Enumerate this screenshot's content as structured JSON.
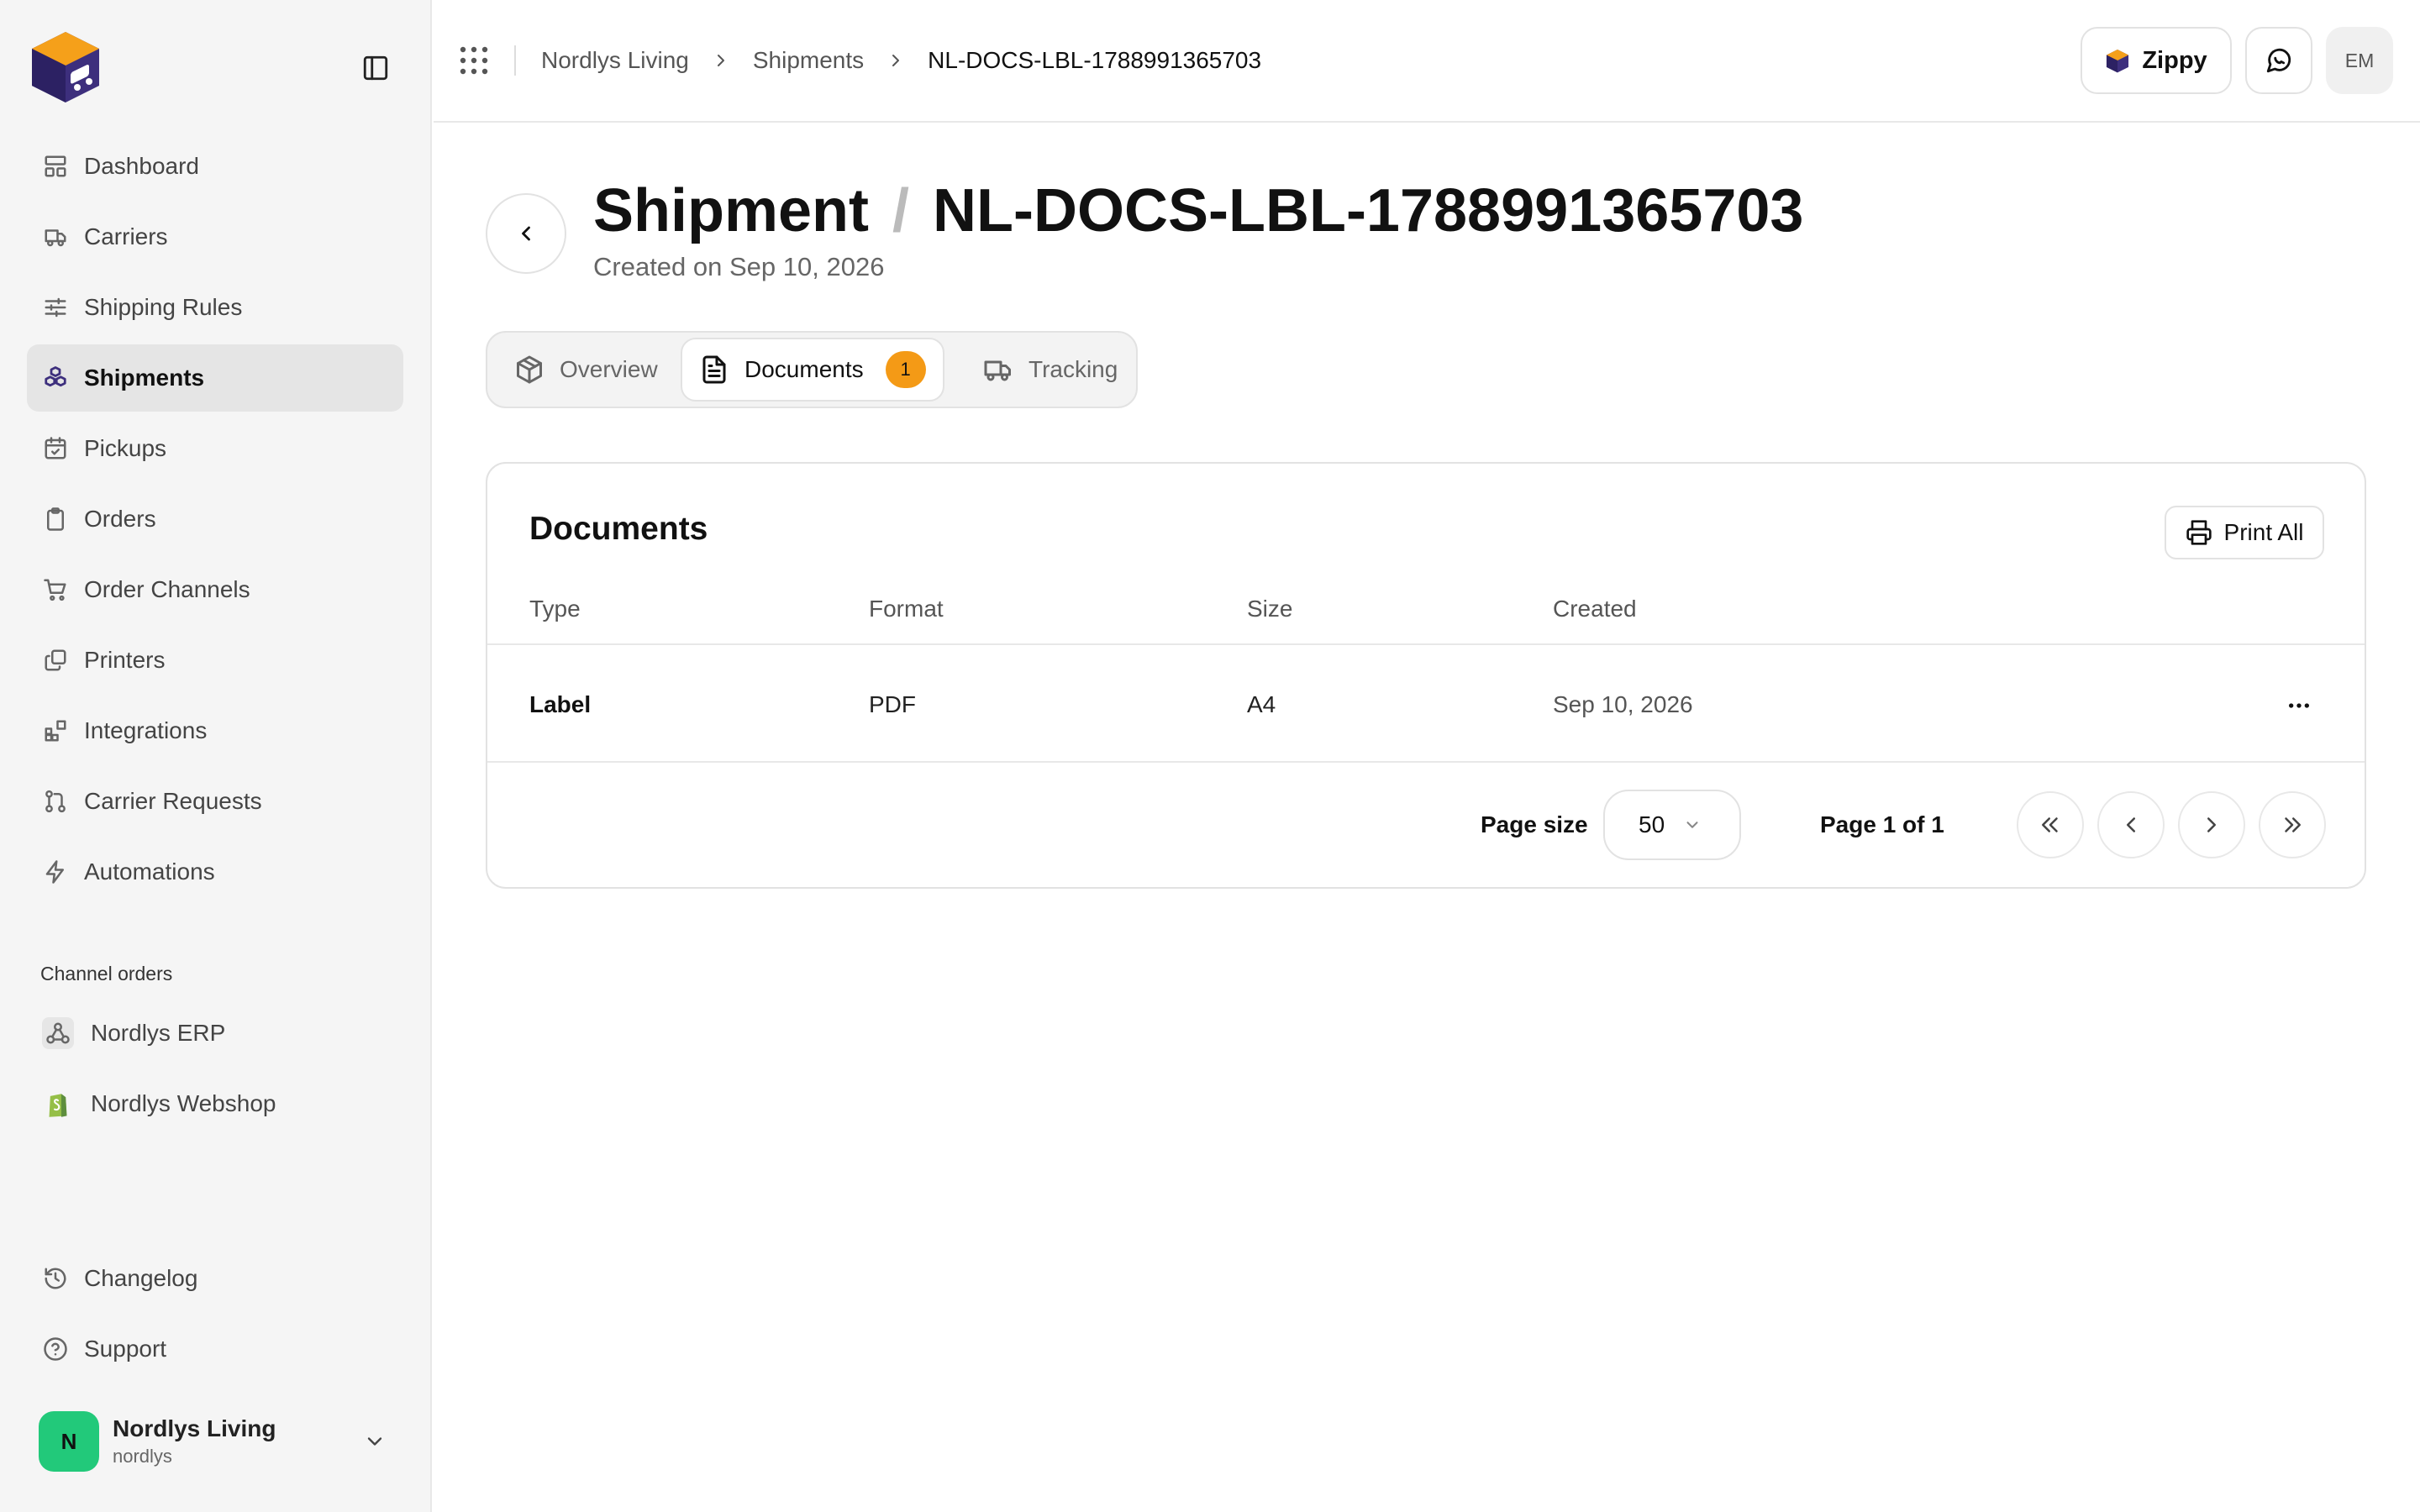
{
  "sidebar": {
    "nav": [
      {
        "label": "Dashboard",
        "icon": "dashboard-icon"
      },
      {
        "label": "Carriers",
        "icon": "truck-icon"
      },
      {
        "label": "Shipping Rules",
        "icon": "sliders-icon"
      },
      {
        "label": "Shipments",
        "icon": "boxes-icon",
        "active": true
      },
      {
        "label": "Pickups",
        "icon": "calendar-check-icon"
      },
      {
        "label": "Orders",
        "icon": "clipboard-icon"
      },
      {
        "label": "Order Channels",
        "icon": "cart-icon"
      },
      {
        "label": "Printers",
        "icon": "copy-icon"
      },
      {
        "label": "Integrations",
        "icon": "blocks-icon"
      },
      {
        "label": "Carrier Requests",
        "icon": "git-pull-request-icon"
      },
      {
        "label": "Automations",
        "icon": "zap-icon"
      }
    ],
    "section_title": "Channel orders",
    "channels": [
      {
        "label": "Nordlys ERP",
        "icon": "webhook-icon"
      },
      {
        "label": "Nordlys Webshop",
        "icon": "shopify-icon"
      }
    ],
    "bottom": [
      {
        "label": "Changelog",
        "icon": "history-icon"
      },
      {
        "label": "Support",
        "icon": "help-circle-icon"
      }
    ],
    "account": {
      "initial": "N",
      "name": "Nordlys Living",
      "handle": "nordlys"
    }
  },
  "header": {
    "breadcrumb": [
      "Nordlys Living",
      "Shipments",
      "NL-DOCS-LBL-1788991365703"
    ],
    "zippy_label": "Zippy",
    "user_initials": "EM"
  },
  "page": {
    "title_prefix": "Shipment",
    "title_separator": "/",
    "title_id": "NL-DOCS-LBL-1788991365703",
    "subtitle": "Created on Sep 10, 2026"
  },
  "tabs": [
    {
      "label": "Overview",
      "icon": "package-icon"
    },
    {
      "label": "Documents",
      "icon": "file-text-icon",
      "badge": "1",
      "active": true
    },
    {
      "label": "Tracking",
      "icon": "truck-icon"
    }
  ],
  "documents": {
    "title": "Documents",
    "print_all_label": "Print All",
    "columns": [
      "Type",
      "Format",
      "Size",
      "Created"
    ],
    "rows": [
      {
        "type": "Label",
        "format": "PDF",
        "size": "A4",
        "created": "Sep 10, 2026"
      }
    ],
    "pagination": {
      "page_size_label": "Page size",
      "page_size_value": "50",
      "page_info": "Page 1 of 1"
    }
  },
  "colors": {
    "accent_badge": "#f49a16",
    "avatar_green": "#22c97a",
    "brand_purple": "#3d2f7d",
    "brand_orange": "#f5a01a"
  }
}
